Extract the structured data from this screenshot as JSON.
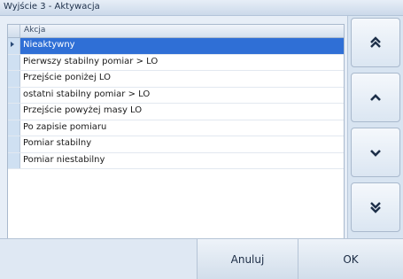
{
  "window": {
    "title": "Wyjście 3 - Aktywacja"
  },
  "grid": {
    "column_header": "Akcja",
    "selected_index": 0,
    "rows": [
      "Nieaktywny",
      "Pierwszy stabilny pomiar > LO",
      "Przejście poniżej LO",
      "ostatni stabilny pomiar > LO",
      "Przejście powyżej masy LO",
      "Po zapisie pomiaru",
      "Pomiar stabilny",
      "Pomiar niestabilny"
    ]
  },
  "nav_buttons": {
    "icons": [
      "double-up-chevron-icon",
      "up-chevron-icon",
      "down-chevron-icon",
      "double-down-chevron-icon"
    ]
  },
  "footer": {
    "cancel_label": "Anuluj",
    "ok_label": "OK"
  }
}
